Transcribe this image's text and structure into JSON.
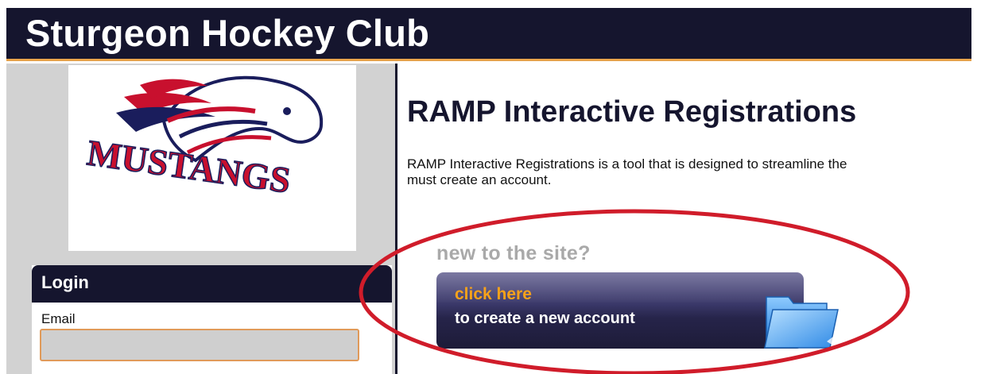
{
  "header": {
    "title": "Sturgeon Hockey Club"
  },
  "logo": {
    "wordmark": "MUSTANGS"
  },
  "login": {
    "title": "Login",
    "email_label": "Email",
    "email_value": ""
  },
  "main": {
    "heading": "RAMP Interactive Registrations",
    "intro_line1": "RAMP Interactive Registrations is a tool that is designed to streamline the",
    "intro_line2": "must create an account.",
    "new_to_site": "new to the site?",
    "button_click_here": "click here",
    "button_create": "to create a new account"
  },
  "colors": {
    "navy": "#15152e",
    "accent_orange": "#f7a21a",
    "annotation_red": "#d01c2a"
  }
}
